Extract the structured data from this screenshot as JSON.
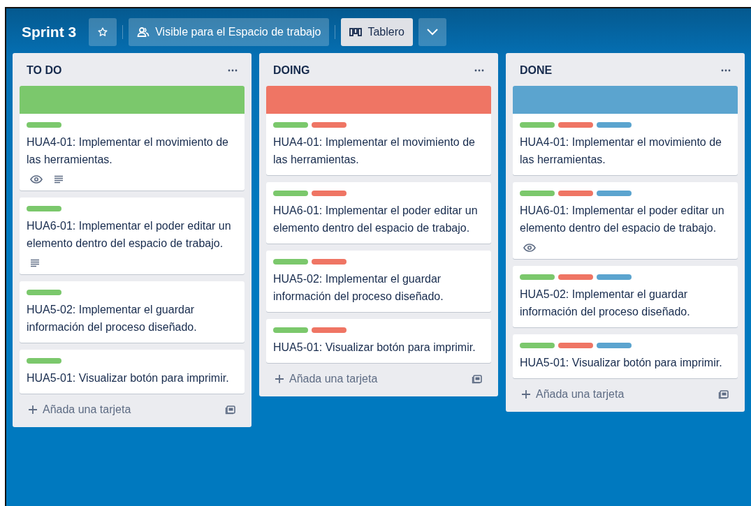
{
  "board": {
    "title": "Sprint 3",
    "starred": false,
    "visibility": "Visible para el Espacio de trabajo",
    "view": "Tablero"
  },
  "lists": [
    {
      "title": "TO DO",
      "cover": {
        "color": "#7bc86c"
      },
      "add_card": "Añada una tarjeta",
      "cards": [
        {
          "labels": [
            {
              "color": "#7bc86c"
            }
          ],
          "title": "HUA4-01: Implementar el movimiento de las herramientas.",
          "badges": [
            {
              "kind": "watch"
            },
            {
              "kind": "description"
            }
          ]
        },
        {
          "labels": [
            {
              "color": "#7bc86c"
            }
          ],
          "title": "HUA6-01: Implementar el poder editar un elemento dentro del espacio de trabajo.",
          "badges": [
            {
              "kind": "description"
            }
          ]
        },
        {
          "labels": [
            {
              "color": "#7bc86c"
            }
          ],
          "title": "HUA5-02: Implementar el guardar información del proceso diseñado."
        },
        {
          "labels": [
            {
              "color": "#7bc86c"
            }
          ],
          "title": "HUA5-01: Visualizar botón para imprimir."
        }
      ]
    },
    {
      "title": "DOING",
      "cover": {
        "color": "#ef7564"
      },
      "add_card": "Añada una tarjeta",
      "cards": [
        {
          "labels": [
            {
              "color": "#7bc86c"
            },
            {
              "color": "#ef7564"
            }
          ],
          "title": "HUA4-01: Implementar el movimiento de las herramientas."
        },
        {
          "labels": [
            {
              "color": "#7bc86c"
            },
            {
              "color": "#ef7564"
            }
          ],
          "title": "HUA6-01: Implementar el poder editar un elemento dentro del espacio de trabajo."
        },
        {
          "labels": [
            {
              "color": "#7bc86c"
            },
            {
              "color": "#ef7564"
            }
          ],
          "title": "HUA5-02: Implementar el guardar información del proceso diseñado."
        },
        {
          "labels": [
            {
              "color": "#7bc86c"
            },
            {
              "color": "#ef7564"
            }
          ],
          "title": "HUA5-01: Visualizar botón para imprimir."
        }
      ]
    },
    {
      "title": "DONE",
      "cover": {
        "color": "#5ba4cf"
      },
      "add_card": "Añada una tarjeta",
      "cards": [
        {
          "labels": [
            {
              "color": "#7bc86c"
            },
            {
              "color": "#ef7564"
            },
            {
              "color": "#5ba4cf"
            }
          ],
          "title": "HUA4-01: Implementar el movimiento de las herramientas."
        },
        {
          "labels": [
            {
              "color": "#7bc86c"
            },
            {
              "color": "#ef7564"
            },
            {
              "color": "#5ba4cf"
            }
          ],
          "title": "HUA6-01: Implementar el poder editar un elemento dentro del espacio de trabajo.",
          "badges": [
            {
              "kind": "watch"
            }
          ]
        },
        {
          "labels": [
            {
              "color": "#7bc86c"
            },
            {
              "color": "#ef7564"
            },
            {
              "color": "#5ba4cf"
            }
          ],
          "title": "HUA5-02: Implementar el guardar información del proceso diseñado."
        },
        {
          "labels": [
            {
              "color": "#7bc86c"
            },
            {
              "color": "#ef7564"
            },
            {
              "color": "#5ba4cf"
            }
          ],
          "title": "HUA5-01: Visualizar botón para imprimir."
        }
      ]
    }
  ]
}
